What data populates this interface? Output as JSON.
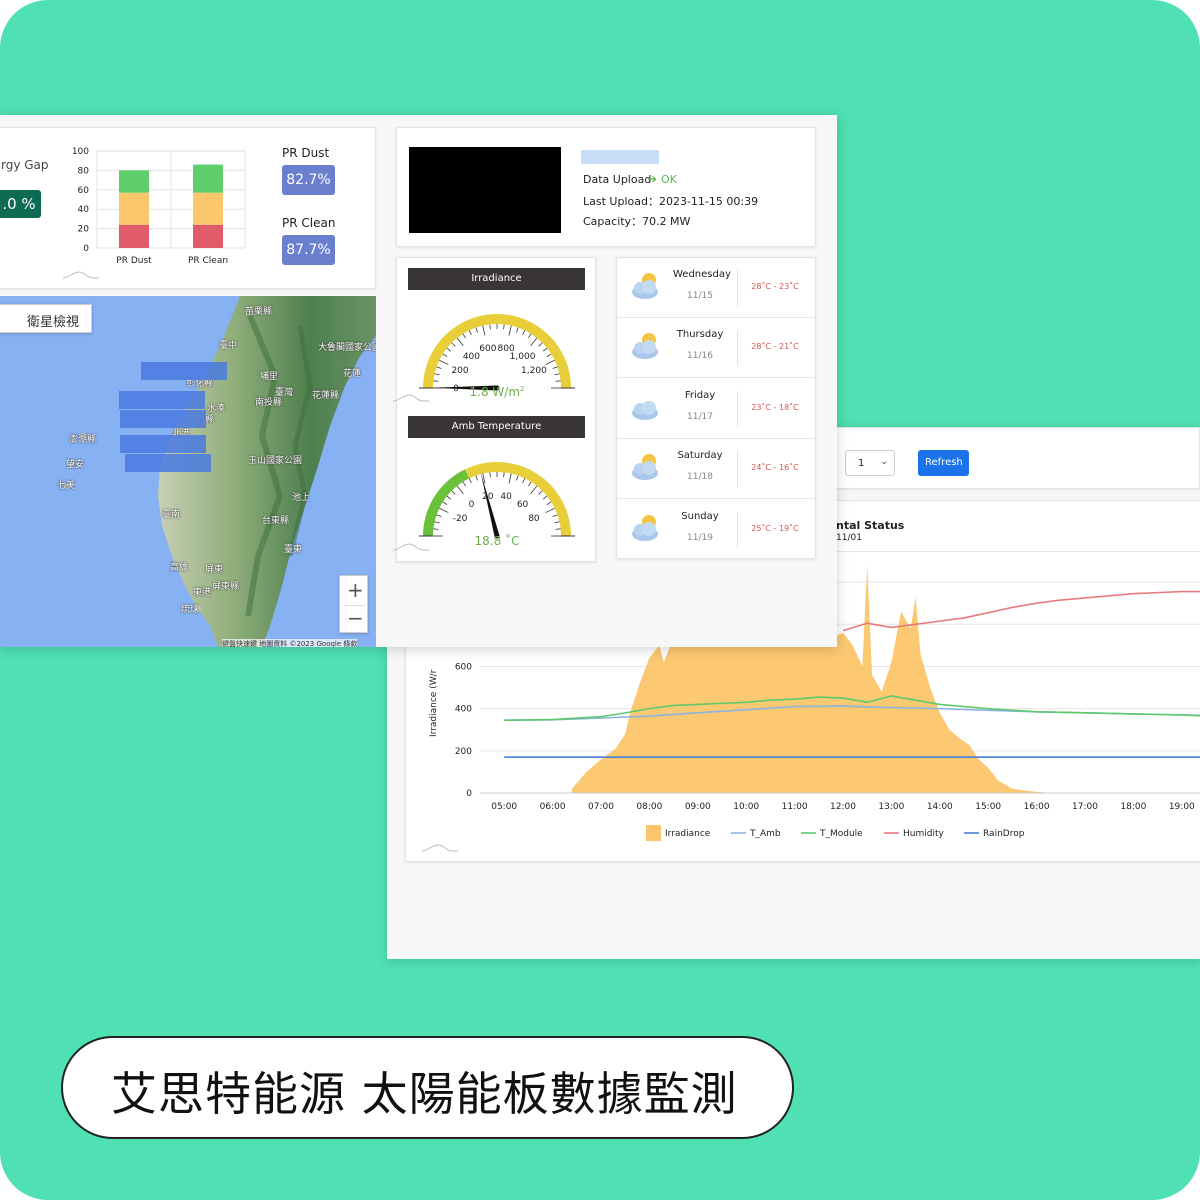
{
  "banner": {
    "title": "艾思特能源 太陽能板數據監測"
  },
  "pr_card": {
    "gap_label": "rgy Gap",
    "gap_value": ".0 %",
    "y_ticks": [
      "100",
      "80",
      "60",
      "40",
      "20",
      "0"
    ],
    "bars": [
      {
        "label": "PR Dust",
        "segments": [
          {
            "from": 0,
            "to": 24,
            "color": "#e05c6a"
          },
          {
            "from": 24,
            "to": 57,
            "color": "#fcc76b"
          },
          {
            "from": 57,
            "to": 80,
            "color": "#5fcf6b"
          }
        ]
      },
      {
        "label": "PR Clean",
        "segments": [
          {
            "from": 0,
            "to": 24,
            "color": "#e05c6a"
          },
          {
            "from": 24,
            "to": 57,
            "color": "#fcc76b"
          },
          {
            "from": 57,
            "to": 86,
            "color": "#5fcf6b"
          }
        ]
      }
    ],
    "pr_dust_label": "PR Dust",
    "pr_dust_value": "82.7%",
    "pr_clean_label": "PR Clean",
    "pr_clean_value": "87.7%"
  },
  "map": {
    "tab_label": "衛星檢視",
    "zoom_in": "+",
    "zoom_out": "−",
    "attribution": "鍵盤快速鍵  地圖資料 ©2023 Google  條款",
    "place_labels": [
      {
        "text": "苗栗縣"
      },
      {
        "text": "臺中"
      },
      {
        "text": "大魯閣國家公園"
      },
      {
        "text": "彰化縣"
      },
      {
        "text": "埔里"
      },
      {
        "text": "花蓮"
      },
      {
        "text": "臺灣"
      },
      {
        "text": "南投縣"
      },
      {
        "text": "花蓮縣"
      },
      {
        "text": "水湊"
      },
      {
        "text": "縣"
      },
      {
        "text": "北港"
      },
      {
        "text": "澎湖縣"
      },
      {
        "text": "望安"
      },
      {
        "text": "七美"
      },
      {
        "text": "玉山國家公園"
      },
      {
        "text": "池上"
      },
      {
        "text": "臺南"
      },
      {
        "text": "台東縣"
      },
      {
        "text": "臺東"
      },
      {
        "text": "高雄"
      },
      {
        "text": "屏東"
      },
      {
        "text": "東港"
      },
      {
        "text": "屏東縣"
      },
      {
        "text": "琉球"
      }
    ]
  },
  "station": {
    "data_upload_label": "Data Upload",
    "data_upload_status": "OK",
    "last_upload": "Last Upload：2023-11-15 00:39",
    "capacity": "Capacity：70.2 MW",
    "status_color": "#5cb85c"
  },
  "irradiance_gauge": {
    "title": "Irradiance",
    "ticks": [
      "0",
      "200",
      "400",
      "600",
      "800",
      "1,000",
      "1,200"
    ],
    "value": 1.8,
    "value_num": "1.8",
    "unit": " W/m",
    "unit_sup": "2",
    "min": 0,
    "max": 1400
  },
  "temp_gauge": {
    "title": "Amb Temperature",
    "ticks": [
      "-20",
      "0",
      "20",
      "40",
      "60",
      "80"
    ],
    "value": 18.8,
    "value_text": "18.8 ˚C",
    "min": -40,
    "max": 100
  },
  "weather": [
    {
      "day": "Wednesday",
      "date": "11/15",
      "temp": "28˚C - 23˚C",
      "icon": "sun-cloud-icon"
    },
    {
      "day": "Thursday",
      "date": "11/16",
      "temp": "28˚C - 21˚C",
      "icon": "sun-cloud-icon"
    },
    {
      "day": "Friday",
      "date": "11/17",
      "temp": "23˚C - 18˚C",
      "icon": "cloud-icon"
    },
    {
      "day": "Saturday",
      "date": "11/18",
      "temp": "24˚C - 16˚C",
      "icon": "sun-cloud-icon"
    },
    {
      "day": "Sunday",
      "date": "11/19",
      "temp": "25˚C - 19˚C",
      "icon": "sun-cloud-icon"
    }
  ],
  "controls": {
    "select_value": "1",
    "refresh_label": "Refresh"
  },
  "env_chart": {
    "title": "ntal Status",
    "subtitle": "11/01"
  },
  "chart_data": {
    "type": "area",
    "ylabel": "Irradiance (W/r",
    "y_ticks": [
      "0",
      "200",
      "400",
      "600"
    ],
    "ylim": [
      0,
      1100
    ],
    "xlim": [
      4.5,
      19.5
    ],
    "x_tick_labels": [
      "05:00",
      "06:00",
      "07:00",
      "08:00",
      "09:00",
      "10:00",
      "11:00",
      "12:00",
      "13:00",
      "14:00",
      "15:00",
      "16:00",
      "17:00",
      "18:00",
      "19:00"
    ],
    "legend": [
      "Irradiance",
      "T_Amb",
      "T_Module",
      "Humidity",
      "RainDrop"
    ],
    "series": [
      {
        "name": "Irradiance",
        "type": "area",
        "color": "#fcc56a",
        "x": [
          6.4,
          6.7,
          7.0,
          7.3,
          7.5,
          7.6,
          7.8,
          8.0,
          8.2,
          8.3,
          8.5,
          8.7,
          8.8,
          9.0,
          9.2,
          9.4,
          9.6,
          9.8,
          10.0,
          10.2,
          10.4,
          10.6,
          10.8,
          11.0,
          11.2,
          11.4,
          11.6,
          11.8,
          12.0,
          12.2,
          12.4,
          12.5,
          12.6,
          12.8,
          13.0,
          13.2,
          13.4,
          13.5,
          13.6,
          13.8,
          14.0,
          14.2,
          14.4,
          14.6,
          14.8,
          15.0,
          15.2,
          15.5,
          15.8,
          16.3
        ],
        "y": [
          20,
          100,
          160,
          210,
          280,
          380,
          520,
          640,
          700,
          620,
          740,
          760,
          700,
          780,
          720,
          760,
          820,
          700,
          760,
          880,
          720,
          840,
          700,
          900,
          760,
          980,
          700,
          740,
          760,
          700,
          600,
          1080,
          560,
          480,
          620,
          860,
          780,
          930,
          660,
          500,
          380,
          300,
          260,
          230,
          160,
          120,
          60,
          20,
          10,
          0
        ]
      },
      {
        "name": "T_Amb",
        "type": "line",
        "color": "#8ab4e0",
        "x": [
          5.0,
          6.0,
          7.0,
          8.0,
          9.0,
          10.0,
          11.0,
          12.0,
          13.0,
          14.0,
          15.0,
          16.0,
          17.0,
          18.0,
          19.0,
          19.5
        ],
        "y": [
          345,
          347,
          355,
          365,
          380,
          395,
          410,
          412,
          405,
          400,
          392,
          385,
          380,
          375,
          370,
          368
        ]
      },
      {
        "name": "T_Module",
        "type": "line",
        "color": "#5cc96a",
        "x": [
          5.0,
          6.0,
          7.0,
          7.5,
          8.0,
          8.5,
          9.0,
          9.5,
          10.0,
          10.5,
          11.0,
          11.5,
          12.0,
          12.5,
          13.0,
          13.5,
          14.0,
          15.0,
          16.0,
          17.0,
          18.0,
          19.0,
          19.5
        ],
        "y": [
          345,
          348,
          362,
          380,
          400,
          415,
          420,
          425,
          430,
          440,
          445,
          455,
          450,
          430,
          460,
          440,
          420,
          400,
          385,
          380,
          375,
          370,
          365
        ]
      },
      {
        "name": "Humidity",
        "type": "line",
        "color": "#e87a7a",
        "x": [
          12.0,
          12.5,
          13.0,
          13.5,
          14.0,
          14.5,
          15.0,
          15.5,
          16.0,
          16.5,
          17.0,
          17.5,
          18.0,
          18.5,
          19.0,
          19.5
        ],
        "y": [
          770,
          805,
          785,
          800,
          815,
          830,
          855,
          880,
          900,
          915,
          925,
          935,
          945,
          950,
          955,
          955
        ]
      },
      {
        "name": "RainDrop",
        "type": "line",
        "color": "#4a7fd4",
        "x": [
          5.0,
          19.5
        ],
        "y": [
          170,
          170
        ]
      }
    ]
  }
}
